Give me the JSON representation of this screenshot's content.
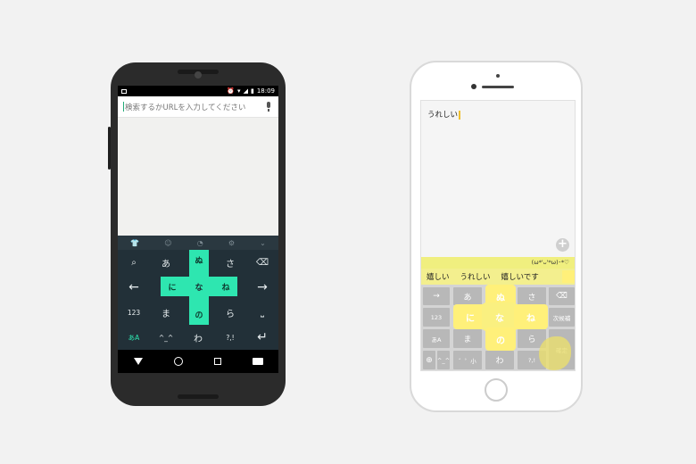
{
  "android": {
    "status": {
      "time": "18:09"
    },
    "search": {
      "placeholder": "検索するかURLを入力してください"
    },
    "toolbar_icons": [
      "shirt-icon",
      "smile-icon",
      "kaomoji-icon",
      "gear-icon",
      "chevron-down-icon"
    ],
    "keys": {
      "search_key": "⌕",
      "a": "あ",
      "sa": "さ",
      "backspace": "⌫",
      "left": "←",
      "right": "→",
      "num": "123",
      "ma": "ま",
      "ra": "ら",
      "space": "⎵",
      "mode": "あA",
      "kaomoji": "^_^",
      "wa": "わ",
      "punct": "?,!",
      "enter": "↵"
    },
    "flick": {
      "up": "ぬ",
      "left": "に",
      "center": "な",
      "right": "ね",
      "down": "の"
    },
    "accent": "#2ee6b0",
    "nav_icons": [
      "back-icon",
      "home-icon",
      "recent-apps-icon",
      "keyboard-switch-icon"
    ]
  },
  "iphone": {
    "typed": "うれしい",
    "emoji_row": "(ω*'ᴗ'*ω)･*♡",
    "candidates": [
      "嬉しい",
      "うれしい",
      "嬉しいです"
    ],
    "keys": {
      "right": "→",
      "a": "あ",
      "sa": "さ",
      "backspace": "⌫",
      "num": "123",
      "next_candidate": "次候補",
      "mode": "あA",
      "ma": "ま",
      "ra": "ら",
      "globe": "⊕",
      "kaomoji": "^_^",
      "dakuten": "゛゜小",
      "wa": "わ",
      "punct": "?,!",
      "confirm": "確定"
    },
    "flick": {
      "up": "ぬ",
      "left": "に",
      "center": "な",
      "right": "ね",
      "down": "の"
    },
    "accent": "#fff07a"
  }
}
